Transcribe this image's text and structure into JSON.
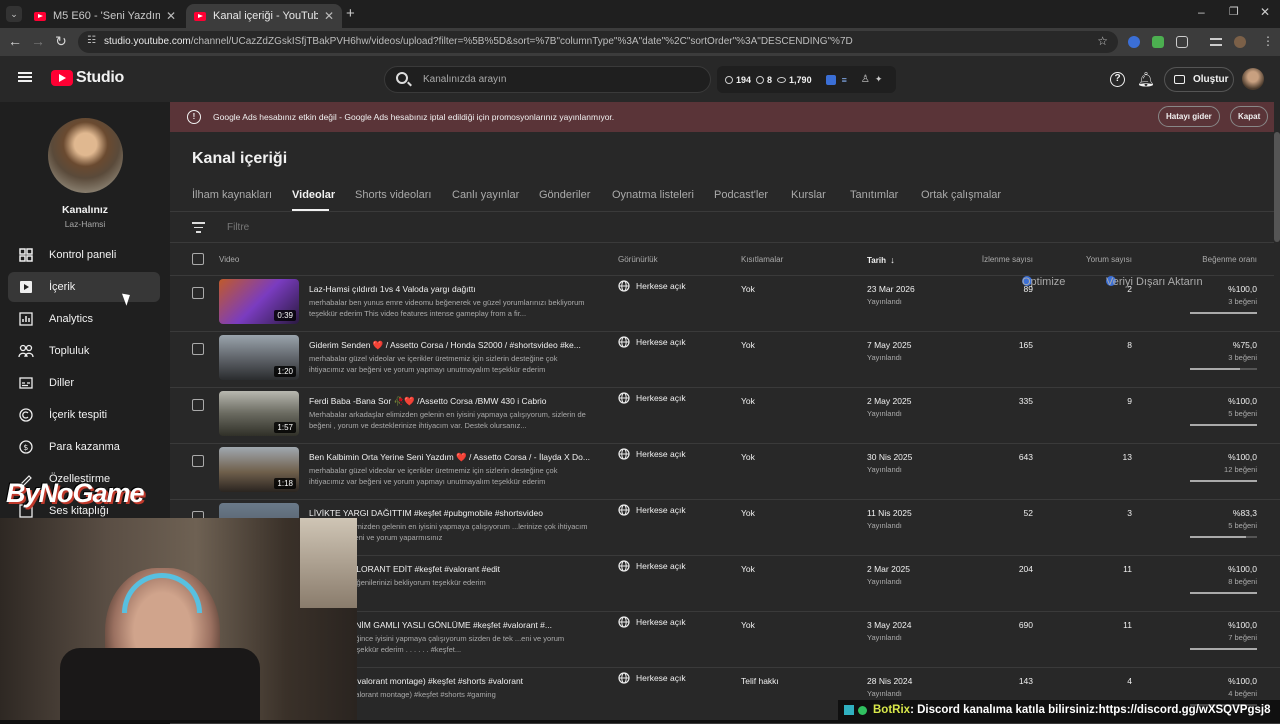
{
  "browser": {
    "tabs": [
      {
        "title": "M5 E60 - 'Seni Yazdım' Müslüm",
        "active": false
      },
      {
        "title": "Kanal içeriği - YouTube Studio",
        "active": true
      }
    ],
    "url_host": "studio.youtube.com",
    "url_rest": "/channel/UCazZdZGskISfjTBakPVH6hw/videos/upload?filter=%5B%5D&sort=%7B\"columnType\"%3A\"date\"%2C\"sortOrder\"%3A\"DESCENDING\"%7D"
  },
  "header": {
    "logo_text": "Studio",
    "search_placeholder": "Kanalınızda arayın",
    "stats": [
      "194",
      "8",
      "1,790"
    ],
    "create_label": "Oluştur"
  },
  "channel": {
    "name": "Kanalınız",
    "handle": "Laz-Hamsi"
  },
  "sidebar": {
    "items": [
      {
        "label": "Kontrol paneli",
        "icon": "dashboard-icon"
      },
      {
        "label": "İçerik",
        "icon": "content-icon",
        "active": true
      },
      {
        "label": "Analytics",
        "icon": "analytics-icon"
      },
      {
        "label": "Topluluk",
        "icon": "community-icon"
      },
      {
        "label": "Diller",
        "icon": "subtitles-icon"
      },
      {
        "label": "İçerik tespiti",
        "icon": "copyright-icon"
      },
      {
        "label": "Para kazanma",
        "icon": "dollar-icon"
      },
      {
        "label": "Özelleştirme",
        "icon": "customize-icon"
      },
      {
        "label": "Ses kitaplığı",
        "icon": "audio-library-icon"
      }
    ]
  },
  "banner": {
    "message": "Google Ads hesabınız etkin değil - Google Ads hesabınız iptal edildiği için promosyonlarınız yayınlanmıyor.",
    "fix_label": "Hatayı gider",
    "close_label": "Kapat"
  },
  "page": {
    "title": "Kanal içeriği",
    "tabs": [
      "İlham kaynakları",
      "Videolar",
      "Shorts videoları",
      "Canlı yayınlar",
      "Gönderiler",
      "Oynatma listeleri",
      "Podcast'ler",
      "Kurslar",
      "Tanıtımlar",
      "Ortak çalışmalar",
      "Optimize",
      "Veriyi Dışarı Aktarın"
    ],
    "filter_placeholder": "Filtre"
  },
  "table": {
    "headers": {
      "video": "Video",
      "visibility": "Görünürlük",
      "restrictions": "Kısıtlamalar",
      "date": "Tarih",
      "views": "İzlenme sayısı",
      "comments": "Yorum sayısı",
      "likes": "Beğenme oranı"
    },
    "rows": [
      {
        "title": "Laz-Hamsi çıldırdı 1vs 4 Valoda yargı dağıttı",
        "desc": "merhabalar ben yunus emre videomu beğenerek ve güzel yorumlarınızı bekliyorum teşekkür ederim This video features intense gameplay from a fir...",
        "duration": "0:39",
        "visibility": "Herkese açık",
        "restrictions": "Yok",
        "date": "23 Mar 2026",
        "status": "Yayınlandı",
        "views": "89",
        "comments": "2",
        "ratio": "%100,0",
        "likes": "3 beğeni",
        "ratio_value": 1.0
      },
      {
        "title": "Giderim Senden ❤️ / Assetto Corsa / Honda S2000 / #shortsvideo #ke...",
        "desc": "merhabalar güzel videolar ve içerikler üretmemiz için sizlerin desteğine çok ihtiyacımız var beğeni ve yorum yapmayı unutmayalım teşekkür ederim",
        "duration": "1:20",
        "visibility": "Herkese açık",
        "restrictions": "Yok",
        "date": "7 May 2025",
        "status": "Yayınlandı",
        "views": "165",
        "comments": "8",
        "ratio": "%75,0",
        "likes": "3 beğeni",
        "ratio_value": 0.75
      },
      {
        "title": "Ferdi Baba -Bana Sor 🥀❤️ /Assetto Corsa /BMW 430 i Cabrio",
        "desc": "Merhabalar arkadaşlar elimizden gelenin en iyisini yapmaya çalışıyorum, sizlerin de beğeni , yorum ve desteklerinize ihtiyacım var. Destek olursanız...",
        "duration": "1:57",
        "visibility": "Herkese açık",
        "restrictions": "Yok",
        "date": "2 May 2025",
        "status": "Yayınlandı",
        "views": "335",
        "comments": "9",
        "ratio": "%100,0",
        "likes": "5 beğeni",
        "ratio_value": 1.0
      },
      {
        "title": "Ben Kalbimin Orta Yerine Seni Yazdım ❤️ / Assetto Corsa / - İlayda X Do...",
        "desc": "merhabalar güzel videolar ve içerikler üretmemiz için sizlerin desteğine çok ihtiyacımız var beğeni ve yorum yapmayı unutmayalım teşekkür ederim",
        "duration": "1:18",
        "visibility": "Herkese açık",
        "restrictions": "Yok",
        "date": "30 Nis 2025",
        "status": "Yayınlandı",
        "views": "643",
        "comments": "13",
        "ratio": "%100,0",
        "likes": "12 beğeni",
        "ratio_value": 1.0
      },
      {
        "title": "LİVİKTE YARGI DAĞITTIM #keşfet #pubgmobile #shortsvideo",
        "desc": "...rkadaşlar elimizden gelenin en iyisini yapmaya çalışıyorum ...lerinize çok ihtiyacım var lütfen begeni ve yorum yaparmısınız",
        "duration": "",
        "visibility": "Herkese açık",
        "restrictions": "Yok",
        "date": "11 Nis 2025",
        "status": "Yayınlandı",
        "views": "52",
        "comments": "3",
        "ratio": "%83,3",
        "likes": "5 beğeni",
        "ratio_value": 0.833
      },
      {
        "title": "...İM ❤️ I VALORANT EDİT #keşfet #valorant #edit",
        "desc": "...arınızı ve beğenilerinizi bekliyorum teşekkür ederim",
        "duration": "",
        "visibility": "Herkese açık",
        "restrictions": "Yok",
        "date": "2 Mar 2025",
        "status": "Yayınlandı",
        "views": "204",
        "comments": "11",
        "ratio": "%100,0",
        "likes": "8 beğeni",
        "ratio_value": 1.0
      },
      {
        "title": "...ĞMEN BENİM GAMLI YASLI GÖNLÜME #keşfet #valorant #...",
        "desc": "...limden geldiğince iyisini yapmaya çalışıyorum sizden de tek ...eni ve yorum yaparmanız teşekkür ederim . . . . . . #keşfet...",
        "duration": "",
        "visibility": "Herkese açık",
        "restrictions": "Yok",
        "date": "3 May 2024",
        "status": "Yayınlandı",
        "views": "690",
        "comments": "11",
        "ratio": "%100,0",
        "likes": "7 beğeni",
        "ratio_value": 1.0
      },
      {
        "title": "...enklensin (valorant montage) #keşfet #shorts #valorant",
        "desc": "...enklensin (valorant montage) #keşfet #shorts #gaming",
        "duration": "",
        "visibility": "Herkese açık",
        "restrictions": "Telif hakkı",
        "date": "28 Nis 2024",
        "status": "Yayınlandı",
        "views": "143",
        "comments": "4",
        "ratio": "%100,0",
        "likes": "4 beğeni",
        "ratio_value": 1.0
      }
    ]
  },
  "overlay": {
    "brand": "ByNoGame",
    "ticker_bot": "BotRix",
    "ticker_text": ": Discord kanalıma katıla bilirsiniz:https://discord.gg/wXSQVPgsj8"
  }
}
